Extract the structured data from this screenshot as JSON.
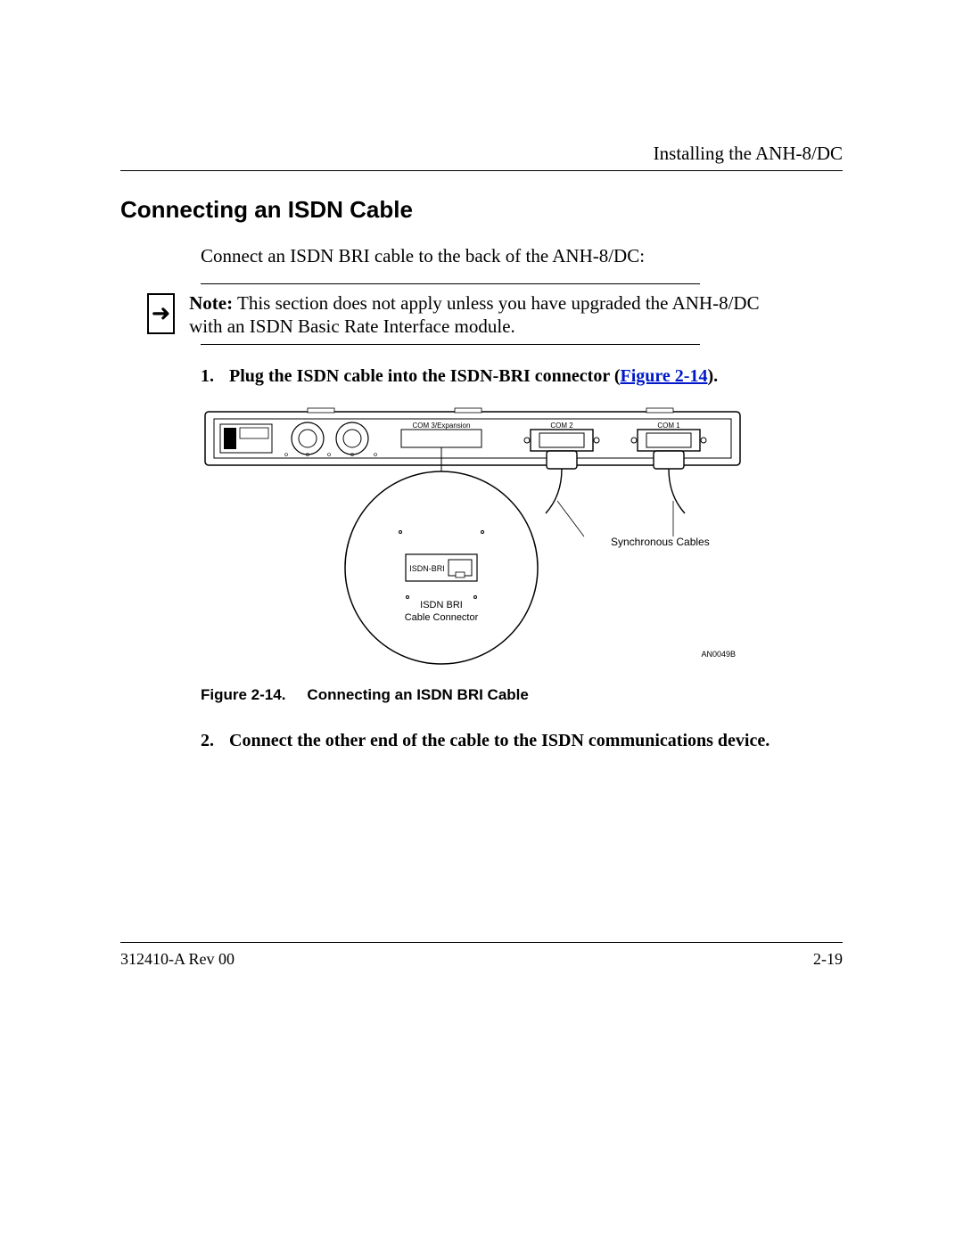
{
  "running_head": "Installing the ANH-8/DC",
  "section_title": "Connecting an ISDN Cable",
  "intro": "Connect an ISDN BRI cable to the back of the ANH-8/DC:",
  "note": {
    "label": "Note:",
    "body": "This section does not apply unless you have upgraded the ANH-8/DC with an ISDN Basic Rate Interface module."
  },
  "steps": {
    "s1_num": "1.",
    "s1_text_a": "Plug the ISDN cable into the ISDN-BRI connector (",
    "s1_link": "Figure 2-14",
    "s1_text_b": ").",
    "s2_num": "2.",
    "s2_text": "Connect the other end of the cable to the ISDN communications device."
  },
  "figure": {
    "device_labels": {
      "com3": "COM 3/Expansion",
      "com2": "COM 2",
      "com1": "COM 1"
    },
    "callout_isdn_port": "ISDN-BRI",
    "callout_connector_line1": "ISDN BRI",
    "callout_connector_line2": "Cable Connector",
    "callout_sync": "Synchronous Cables",
    "art_id": "AN0049B",
    "caption_num": "Figure 2-14.",
    "caption_title": "Connecting an ISDN BRI Cable"
  },
  "footer": {
    "left": "312410-A Rev 00",
    "right": "2-19"
  }
}
